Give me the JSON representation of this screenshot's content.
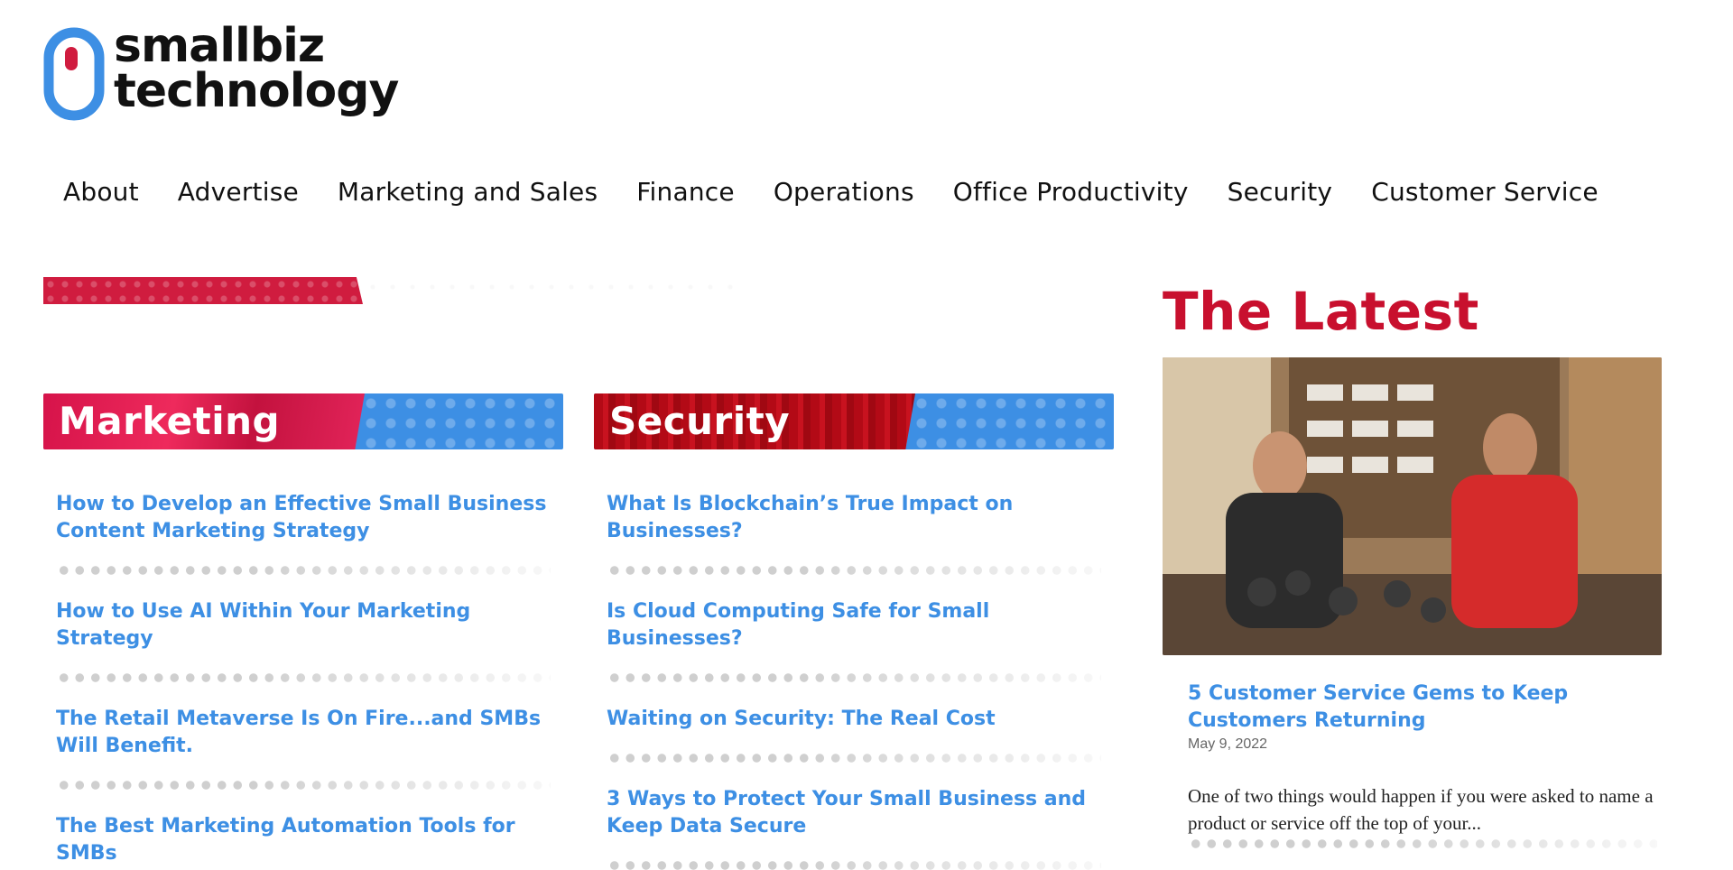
{
  "logo": {
    "line1": "smallbiz",
    "line2": "technology"
  },
  "nav": [
    "About",
    "Advertise",
    "Marketing and Sales",
    "Finance",
    "Operations",
    "Office Productivity",
    "Security",
    "Customer Service"
  ],
  "sections": {
    "marketing": {
      "label": "Marketing",
      "articles": [
        "How to Develop an Effective Small Business Content Marketing Strategy",
        "How to Use AI Within Your Marketing Strategy",
        "The Retail Metaverse Is On Fire...and SMBs Will Benefit.",
        "The Best Marketing Automation Tools for SMBs"
      ]
    },
    "security": {
      "label": "Security",
      "articles": [
        "What Is Blockchain’s True Impact on Businesses?",
        "Is Cloud Computing Safe for Small Businesses?",
        "Waiting on Security: The Real Cost",
        "3 Ways to Protect Your Small Business and Keep Data Secure"
      ]
    }
  },
  "latest": {
    "title": "The Latest",
    "article_title": "5 Customer Service Gems to Keep Customers Returning",
    "date": "May 9, 2022",
    "excerpt": "One of two things would happen if you were asked to name a product or service off the top of your..."
  },
  "colors": {
    "brand_red": "#c8102e",
    "link_blue": "#3d8fe4",
    "banner_blue": "#3d8fe4"
  }
}
